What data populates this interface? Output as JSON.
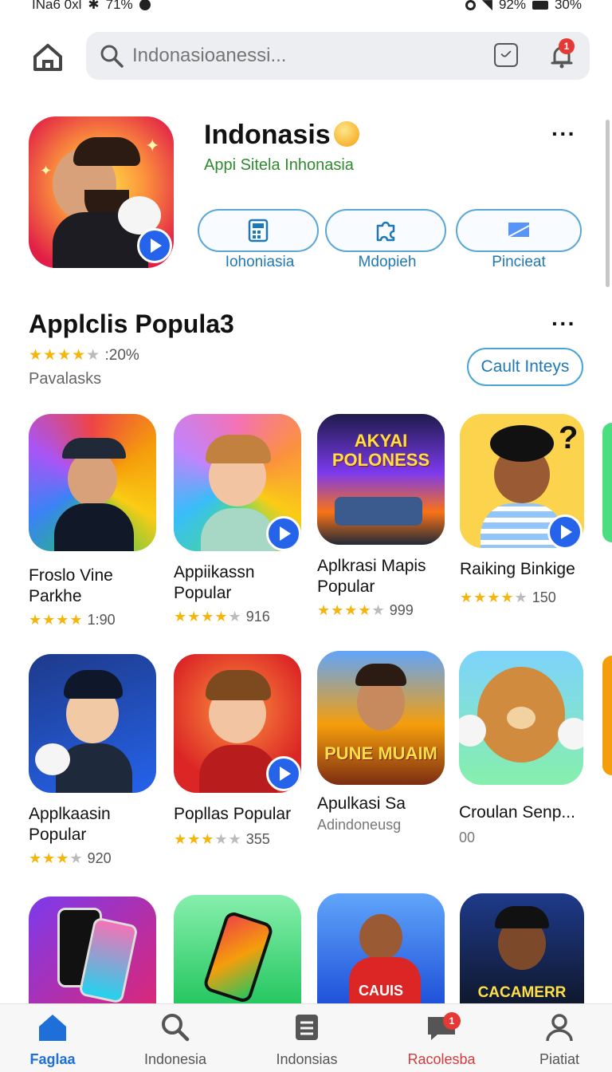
{
  "status_bar": {
    "left_text": "INa6 0xl",
    "left_extra": "71%",
    "battery_a": "92%",
    "battery_b": "30%"
  },
  "search": {
    "placeholder": "Indonasioanessi...",
    "notification_count": "1"
  },
  "featured": {
    "title": "Indonasis",
    "subtitle": "Appi Sitela Inhonasia",
    "actions": [
      {
        "label": "Iohoniasia",
        "icon": "calculator-icon"
      },
      {
        "label": "Mdopieh",
        "icon": "puzzle-icon"
      },
      {
        "label": "Pincieat",
        "icon": "flag-icon"
      }
    ]
  },
  "section": {
    "title": "Applclis Popula3",
    "rating_text": ":20%",
    "rating_stars": 4,
    "subtitle": "Pavalasks",
    "button_label": "Cault Inteys"
  },
  "apps": [
    {
      "name": "Froslo Vine Parkhe",
      "stars": 4,
      "count": "1:90"
    },
    {
      "name": "Appiikassn Popular",
      "stars": 4,
      "count": "916"
    },
    {
      "name": "Aplkrasi Mapis Popular",
      "stars": 4,
      "count": "999",
      "banner": "AKYAI POLONESS"
    },
    {
      "name": "Raiking Binkige",
      "stars": 4,
      "count": "150"
    },
    {
      "name": "Applkaasin Popular",
      "stars": 3.5,
      "count": "920"
    },
    {
      "name": "Popllas Popular",
      "stars": 3.5,
      "count": "355"
    },
    {
      "name": "Apulkasi Sa",
      "sub": "Adindoneusg",
      "banner": "PUNE MUAIM"
    },
    {
      "name": "Croulan Senp...",
      "sub": "00"
    },
    {
      "banner": "CAUIS"
    },
    {
      "banner": "CACAMERR"
    }
  ],
  "bottom_nav": [
    {
      "label": "Faglaa",
      "icon": "home-icon",
      "active": true
    },
    {
      "label": "Indonesia",
      "icon": "search-icon"
    },
    {
      "label": "Indonsias",
      "icon": "list-icon"
    },
    {
      "label": "Racolesba",
      "icon": "chat-icon",
      "badge": "1"
    },
    {
      "label": "Piatiat",
      "icon": "profile-icon"
    }
  ],
  "colors": {
    "accent": "#1e6fd9",
    "outline": "#4aa3d9",
    "star": "#f5b50a",
    "badge": "#e53935"
  }
}
